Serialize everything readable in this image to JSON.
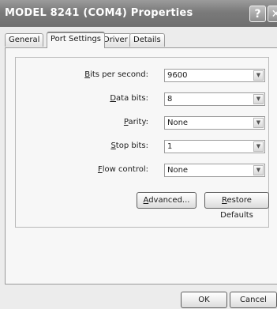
{
  "window": {
    "title": "MODEL 8241 (COM4) Properties",
    "help_glyph": "?",
    "close_glyph": "✕"
  },
  "tabs": [
    {
      "label": "General",
      "active": false
    },
    {
      "label": "Port Settings",
      "active": true
    },
    {
      "label": "Driver",
      "active": false
    },
    {
      "label": "Details",
      "active": false
    }
  ],
  "settings": [
    {
      "label_pre": "",
      "label_key": "B",
      "label_post": "its per second:",
      "value": "9600"
    },
    {
      "label_pre": "",
      "label_key": "D",
      "label_post": "ata bits:",
      "value": "8"
    },
    {
      "label_pre": "",
      "label_key": "P",
      "label_post": "arity:",
      "value": "None"
    },
    {
      "label_pre": "",
      "label_key": "S",
      "label_post": "top bits:",
      "value": "1"
    },
    {
      "label_pre": "",
      "label_key": "F",
      "label_post": "low control:",
      "value": "None"
    }
  ],
  "buttons": {
    "advanced_key": "A",
    "advanced_rest": "dvanced...",
    "restore_key": "R",
    "restore_rest": "estore Defaults",
    "ok": "OK",
    "cancel": "Cancel"
  },
  "icons": {
    "dropdown": "chevron-down-icon"
  }
}
